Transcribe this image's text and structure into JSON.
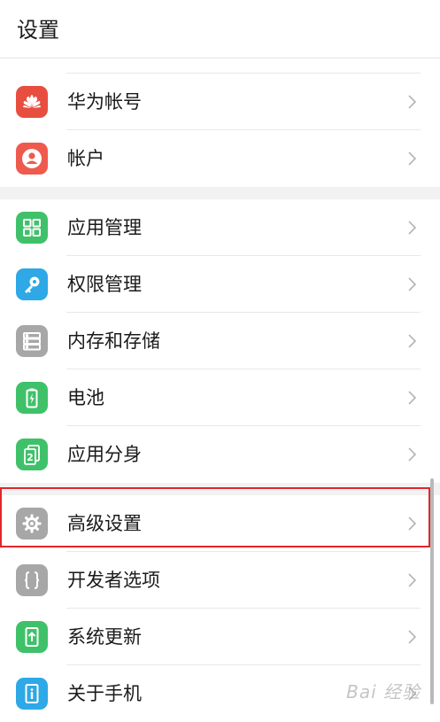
{
  "header": {
    "title": "设置"
  },
  "groups": [
    [
      {
        "label": "华为帐号",
        "icon": "huawei-logo-icon",
        "color": "#e84e40"
      },
      {
        "label": "帐户",
        "icon": "user-account-icon",
        "color": "#ef5a4e"
      }
    ],
    [
      {
        "label": "应用管理",
        "icon": "app-grid-icon",
        "color": "#3fc16a"
      },
      {
        "label": "权限管理",
        "icon": "key-icon",
        "color": "#2ea8e6"
      },
      {
        "label": "内存和存储",
        "icon": "storage-icon",
        "color": "#a7a7a7"
      },
      {
        "label": "电池",
        "icon": "battery-icon",
        "color": "#3fc16a"
      },
      {
        "label": "应用分身",
        "icon": "app-twin-icon",
        "color": "#3fc16a"
      }
    ],
    [
      {
        "label": "高级设置",
        "icon": "gear-icon",
        "color": "#a7a7a7"
      },
      {
        "label": "开发者选项",
        "icon": "braces-icon",
        "color": "#a7a7a7"
      },
      {
        "label": "系统更新",
        "icon": "system-update-icon",
        "color": "#3fc16a"
      },
      {
        "label": "关于手机",
        "icon": "info-icon",
        "color": "#2ea8e6"
      }
    ]
  ],
  "watermark": "Bai 经验",
  "colors": {
    "highlight": "#e2262b",
    "divider": "#e8e8e8",
    "gap": "#f2f2f2"
  }
}
